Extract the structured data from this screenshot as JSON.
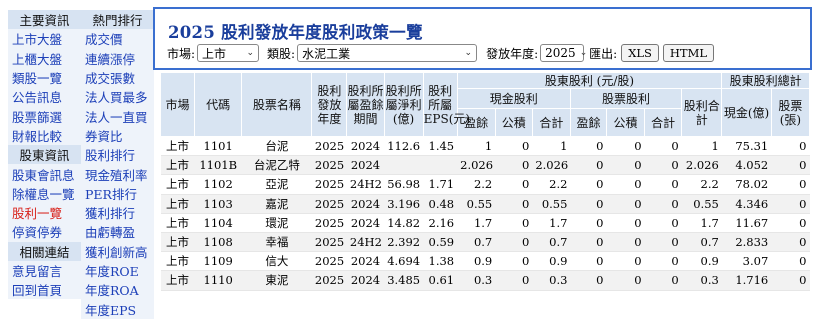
{
  "sidebar": {
    "col1": {
      "header_main": "主要資訊",
      "main_items": [
        "上市大盤",
        "上櫃大盤",
        "類股一覽",
        "公告訊息",
        "股票篩選",
        "財報比較"
      ],
      "header_stock": "股東資訊",
      "stock_items": [
        "股東會訊息",
        "除權息一覽",
        "股利一覽",
        "停資停券"
      ],
      "header_links": "相關連結",
      "link_items": [
        "意見留言",
        "回到首頁"
      ]
    },
    "col2": {
      "header_hot": "熱門排行",
      "hot_items": [
        "成交價",
        "連續漲停",
        "成交張數",
        "法人買最多",
        "法人一直買",
        "券資比",
        "股利排行",
        "現金殖利率",
        "PER排行",
        "獲利排行",
        "由虧轉盈",
        "獲利創新高",
        "年度ROE",
        "年度ROA",
        "年度EPS"
      ]
    },
    "selected_item": "股利一覽"
  },
  "policy": {
    "title": "2025 股利發放年度股利政策一覽",
    "market_label": "市場:",
    "market_value": "上市",
    "category_label": "類股:",
    "category_value": "水泥工業",
    "year_label": "發放年度:",
    "year_value": "2025",
    "export_label": "匯出:",
    "xls_button": "XLS",
    "html_button": "HTML"
  },
  "table": {
    "headers": {
      "market": "市場",
      "code": "代碼",
      "name": "股票名稱",
      "dist_year": "股利發放年度",
      "earn_period": "股利所屬盈餘期間",
      "net_profit": "股利所屬淨利(億)",
      "eps": "股利所屬EPS(元)",
      "holder_dividend": "股東股利 (元/股)",
      "cash_dividend": "現金股利",
      "stock_dividend": "股票股利",
      "surplus": "盈餘",
      "reserve": "公積",
      "subtotal": "合計",
      "dividend_total": "股利合計",
      "holder_total": "股東股利總計",
      "cash_total": "現金(億)",
      "stock_total": "股票(張)"
    },
    "rows": [
      {
        "market": "上市",
        "code": "1101",
        "name": "台泥",
        "year": "2025",
        "period": "2024",
        "profit": "112.6",
        "eps": "1.45",
        "cash_surplus": "1",
        "cash_reserve": "0",
        "cash_sum": "1",
        "stock_surplus": "0",
        "stock_reserve": "0",
        "stock_sum": "0",
        "total": "1",
        "cash_total": "75.31",
        "stock_total": "0"
      },
      {
        "market": "上市",
        "code": "1101B",
        "name": "台泥乙特",
        "year": "2025",
        "period": "2024",
        "profit": "",
        "eps": "",
        "cash_surplus": "2.026",
        "cash_reserve": "0",
        "cash_sum": "2.026",
        "stock_surplus": "0",
        "stock_reserve": "0",
        "stock_sum": "0",
        "total": "2.026",
        "cash_total": "4.052",
        "stock_total": "0"
      },
      {
        "market": "上市",
        "code": "1102",
        "name": "亞泥",
        "year": "2025",
        "period": "24H2",
        "profit": "56.98",
        "eps": "1.71",
        "cash_surplus": "2.2",
        "cash_reserve": "0",
        "cash_sum": "2.2",
        "stock_surplus": "0",
        "stock_reserve": "0",
        "stock_sum": "0",
        "total": "2.2",
        "cash_total": "78.02",
        "stock_total": "0"
      },
      {
        "market": "上市",
        "code": "1103",
        "name": "嘉泥",
        "year": "2025",
        "period": "2024",
        "profit": "3.196",
        "eps": "0.48",
        "cash_surplus": "0.55",
        "cash_reserve": "0",
        "cash_sum": "0.55",
        "stock_surplus": "0",
        "stock_reserve": "0",
        "stock_sum": "0",
        "total": "0.55",
        "cash_total": "4.346",
        "stock_total": "0"
      },
      {
        "market": "上市",
        "code": "1104",
        "name": "環泥",
        "year": "2025",
        "period": "2024",
        "profit": "14.82",
        "eps": "2.16",
        "cash_surplus": "1.7",
        "cash_reserve": "0",
        "cash_sum": "1.7",
        "stock_surplus": "0",
        "stock_reserve": "0",
        "stock_sum": "0",
        "total": "1.7",
        "cash_total": "11.67",
        "stock_total": "0"
      },
      {
        "market": "上市",
        "code": "1108",
        "name": "幸福",
        "year": "2025",
        "period": "24H2",
        "profit": "2.392",
        "eps": "0.59",
        "cash_surplus": "0.7",
        "cash_reserve": "0",
        "cash_sum": "0.7",
        "stock_surplus": "0",
        "stock_reserve": "0",
        "stock_sum": "0",
        "total": "0.7",
        "cash_total": "2.833",
        "stock_total": "0"
      },
      {
        "market": "上市",
        "code": "1109",
        "name": "信大",
        "year": "2025",
        "period": "2024",
        "profit": "4.694",
        "eps": "1.38",
        "cash_surplus": "0.9",
        "cash_reserve": "0",
        "cash_sum": "0.9",
        "stock_surplus": "0",
        "stock_reserve": "0",
        "stock_sum": "0",
        "total": "0.9",
        "cash_total": "3.07",
        "stock_total": "0"
      },
      {
        "market": "上市",
        "code": "1110",
        "name": "東泥",
        "year": "2025",
        "period": "2024",
        "profit": "3.485",
        "eps": "0.61",
        "cash_surplus": "0.3",
        "cash_reserve": "0",
        "cash_sum": "0.3",
        "stock_surplus": "0",
        "stock_reserve": "0",
        "stock_sum": "0",
        "total": "0.3",
        "cash_total": "1.716",
        "stock_total": "0"
      }
    ]
  }
}
